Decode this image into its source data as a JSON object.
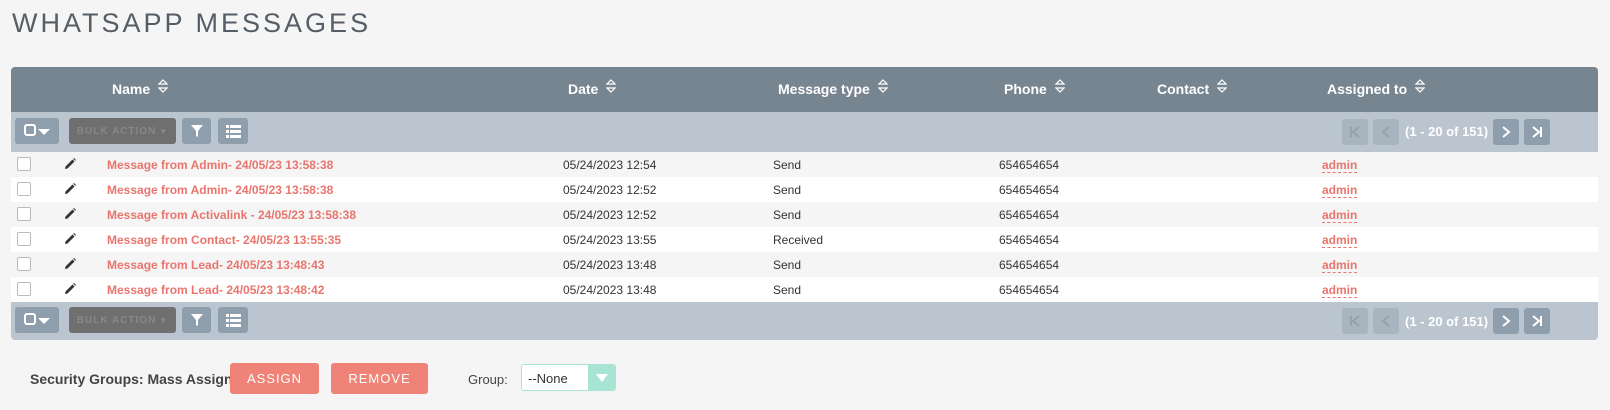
{
  "page": {
    "title": "WHATSAPP MESSAGES"
  },
  "columns": [
    {
      "key": "name",
      "label": "Name"
    },
    {
      "key": "date",
      "label": "Date"
    },
    {
      "key": "message_type",
      "label": "Message type"
    },
    {
      "key": "phone",
      "label": "Phone"
    },
    {
      "key": "contact",
      "label": "Contact"
    },
    {
      "key": "assigned_to",
      "label": "Assigned to"
    }
  ],
  "toolbar": {
    "bulk_action_label": "BULK ACTION",
    "pagination_text": "(1 - 20 of 151)"
  },
  "rows": [
    {
      "name": "Message from Admin- 24/05/23 13:58:38",
      "date": "05/24/2023 12:54",
      "message_type": "Send",
      "phone": "654654654",
      "contact": "",
      "assigned_to": "admin"
    },
    {
      "name": "Message from Admin- 24/05/23 13:58:38",
      "date": "05/24/2023 12:52",
      "message_type": "Send",
      "phone": "654654654",
      "contact": "",
      "assigned_to": "admin"
    },
    {
      "name": "Message from Activalink - 24/05/23 13:58:38",
      "date": "05/24/2023 12:52",
      "message_type": "Send",
      "phone": "654654654",
      "contact": "",
      "assigned_to": "admin"
    },
    {
      "name": "Message from Contact- 24/05/23 13:55:35",
      "date": "05/24/2023 13:55",
      "message_type": "Received",
      "phone": "654654654",
      "contact": "",
      "assigned_to": "admin"
    },
    {
      "name": "Message from Lead- 24/05/23 13:48:43",
      "date": "05/24/2023 13:48",
      "message_type": "Send",
      "phone": "654654654",
      "contact": "",
      "assigned_to": "admin"
    },
    {
      "name": "Message from Lead- 24/05/23 13:48:42",
      "date": "05/24/2023 13:48",
      "message_type": "Send",
      "phone": "654654654",
      "contact": "",
      "assigned_to": "admin"
    }
  ],
  "mass_assign": {
    "label": "Security Groups: Mass Assign",
    "assign_label": "ASSIGN",
    "remove_label": "REMOVE",
    "group_label": "Group:",
    "group_value": "--None"
  },
  "colors": {
    "header_bg": "#778591",
    "toolbar_bg": "#bac5cf",
    "link": "#e9756d",
    "action_button": "#f08377",
    "select_accent": "#a7e4d4"
  },
  "icons": {
    "sort": "sort-icon",
    "edit": "pencil-icon",
    "filter": "filter-icon",
    "columns": "column-chooser-icon",
    "select_all": "checkbox-dropdown-icon",
    "first": "first-page-icon",
    "prev": "prev-page-icon",
    "next": "next-page-icon",
    "last": "last-page-icon"
  }
}
